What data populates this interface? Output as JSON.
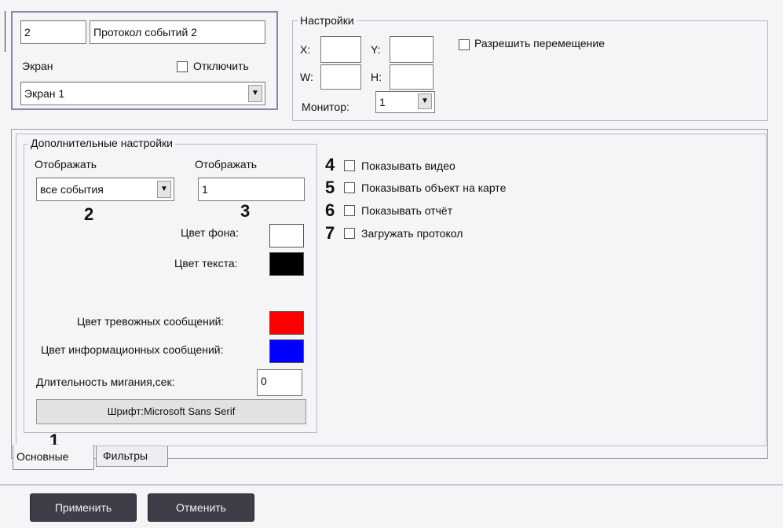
{
  "general": {
    "id": "2",
    "name": "Протокол событий 2",
    "screen_label": "Экран",
    "disable_label": "Отключить",
    "screen_value": "Экран 1"
  },
  "settings": {
    "legend": "Настройки",
    "x_label": "X:",
    "y_label": "Y:",
    "w_label": "W:",
    "h_label": "H:",
    "x_value": "",
    "y_value": "",
    "w_value": "",
    "h_value": "",
    "allow_move_label": "Разрешить перемещение",
    "monitor_label": "Монитор:",
    "monitor_value": "1"
  },
  "extra": {
    "legend": "Дополнительные настройки",
    "display_label_1": "Отображать",
    "display_label_2": "Отображать",
    "events_value": "все события",
    "count_value": "1",
    "bg_color_label": "Цвет фона:",
    "text_color_label": "Цвет текста:",
    "alarm_color_label": "Цвет тревожных сообщений:",
    "info_color_label": "Цвет информационных сообщений:",
    "blink_label": "Длительность мигания,сек:",
    "blink_value": "0",
    "font_button": "Шрифт:Microsoft Sans Serif",
    "colors": {
      "background": "#ffffff",
      "text": "#000000",
      "alarm": "#ff0000",
      "info": "#0000ff"
    }
  },
  "options": {
    "show_video": "Показывать видео",
    "show_on_map": "Показывать объект на карте",
    "show_report": "Показывать отчёт",
    "load_protocol": "Загружать протокол"
  },
  "callouts": {
    "n1": "1",
    "n2": "2",
    "n3": "3",
    "n4": "4",
    "n5": "5",
    "n6": "6",
    "n7": "7"
  },
  "tabs": {
    "main": "Основные",
    "filters": "Фильтры"
  },
  "footer": {
    "apply": "Применить",
    "cancel": "Отменить"
  }
}
